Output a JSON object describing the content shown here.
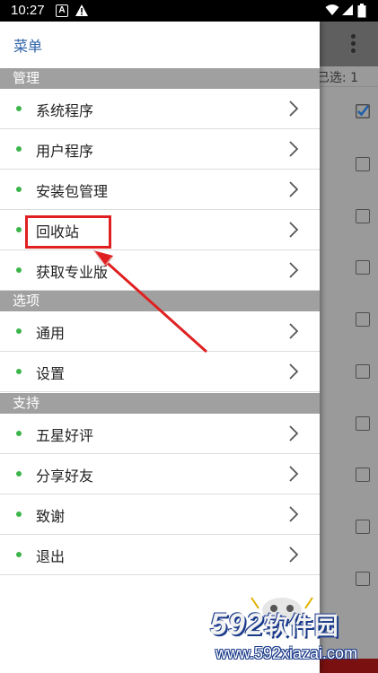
{
  "status_bar": {
    "time": "10:27",
    "notify_letter": "A"
  },
  "app_behind": {
    "selected_label": "已选: 1"
  },
  "drawer": {
    "title": "菜单",
    "sections": [
      {
        "header": "管理",
        "items": [
          "系统程序",
          "用户程序",
          "安装包管理",
          "回收站",
          "获取专业版"
        ]
      },
      {
        "header": "选项",
        "items": [
          "通用",
          "设置"
        ]
      },
      {
        "header": "支持",
        "items": [
          "五星好评",
          "分享好友",
          "致谢",
          "退出"
        ]
      }
    ]
  },
  "watermark": {
    "logo_digits": "592",
    "logo_cn": "软件园",
    "url": "www.592xiazai.com"
  },
  "colors": {
    "accent_dot": "#3cb54a",
    "title_blue": "#2e63a8",
    "highlight_red": "#e02020"
  },
  "icons": [
    "chevron-right-icon",
    "wifi-icon",
    "signal-icon",
    "battery-icon",
    "warning-icon",
    "overflow-menu-icon",
    "checkbox-icon"
  ]
}
